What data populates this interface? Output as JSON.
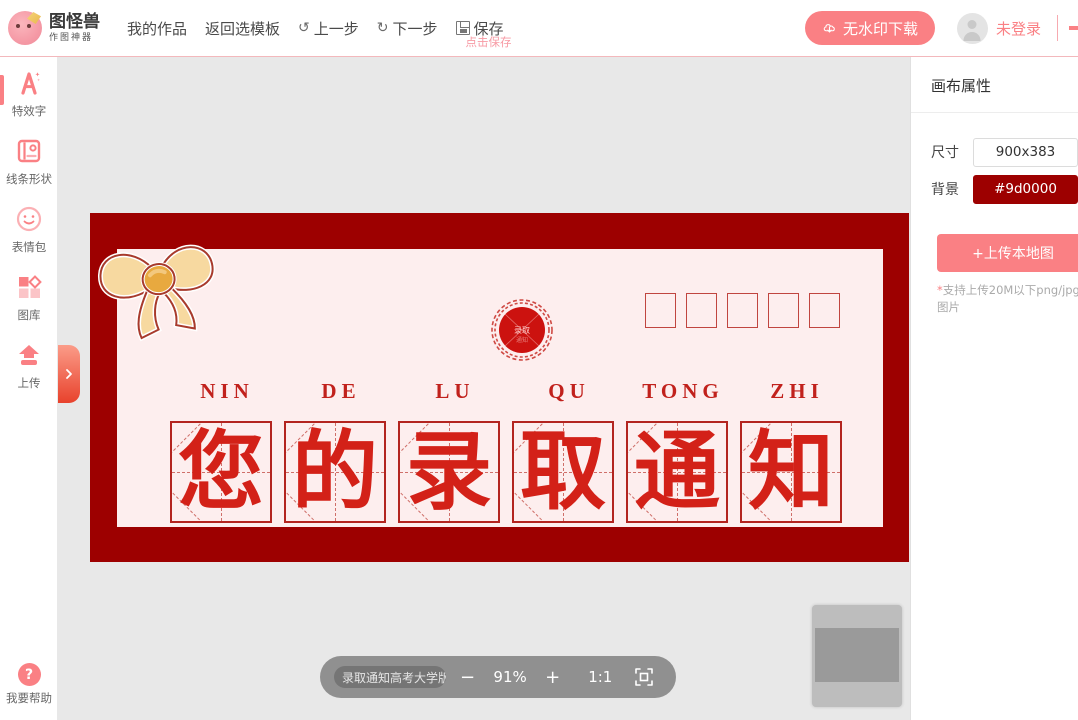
{
  "header": {
    "logo": {
      "title": "图怪兽",
      "subtitle": "作图神器",
      "icon": "monster-mascot-icon"
    },
    "nav": [
      {
        "label": "我的作品",
        "icon": ""
      },
      {
        "label": "返回选模板",
        "icon": ""
      },
      {
        "label": "上一步",
        "icon": "↺"
      },
      {
        "label": "下一步",
        "icon": "↻"
      }
    ],
    "save": {
      "label": "保存",
      "icon": "floppy-disk-icon",
      "hint": "点击保存"
    },
    "download_button": {
      "label": "无水印下载",
      "icon": "cloud-download-icon",
      "color": "#fa8084"
    },
    "user": {
      "label": "未登录",
      "icon": "avatar-icon",
      "color": "#fa8084"
    }
  },
  "sidebar": {
    "items": [
      {
        "label": "特效字",
        "icon": "effect-text-icon",
        "active": true
      },
      {
        "label": "线条形状",
        "icon": "line-shape-icon",
        "active": false
      },
      {
        "label": "表情包",
        "icon": "emoji-icon",
        "active": false
      },
      {
        "label": "图库",
        "icon": "gallery-icon",
        "active": false
      },
      {
        "label": "上传",
        "icon": "upload-icon",
        "active": false
      }
    ],
    "help": {
      "label": "我要帮助",
      "icon": "question-mark-icon"
    }
  },
  "workspace": {
    "expander": {
      "icon": "chevron-right-icon"
    },
    "canvas": {
      "background": "#9d0000",
      "inner_background": "#fdeeee",
      "decorations": {
        "bow": "ribbon-bow-icon",
        "seal": "red-seal-stamp-icon",
        "empty_boxes": 5
      },
      "pinyin": [
        "NIN",
        "DE",
        "LU",
        "QU",
        "TONG",
        "ZHI"
      ],
      "characters": [
        "您",
        "的",
        "录",
        "取",
        "通",
        "知"
      ],
      "text_color": "#d32118",
      "grid_border_color": "#b3241f"
    }
  },
  "zoombar": {
    "document_name": "录取通知高考大学版",
    "zoom_out": "−",
    "zoom_level": "91%",
    "zoom_in": "+",
    "actual_size": "1:1",
    "fit_icon": "fit-to-screen-icon"
  },
  "minimap": {
    "name": "canvas-navigator"
  },
  "right_panel": {
    "title": "画布属性",
    "fields": [
      {
        "label": "尺寸",
        "value": "900x383",
        "name": "size"
      },
      {
        "label": "背景",
        "value": "#9d0000",
        "name": "background"
      }
    ],
    "upload_button": "+上传本地图",
    "note_star": "*",
    "note": "支持上传20M以下png/jpg图片"
  }
}
